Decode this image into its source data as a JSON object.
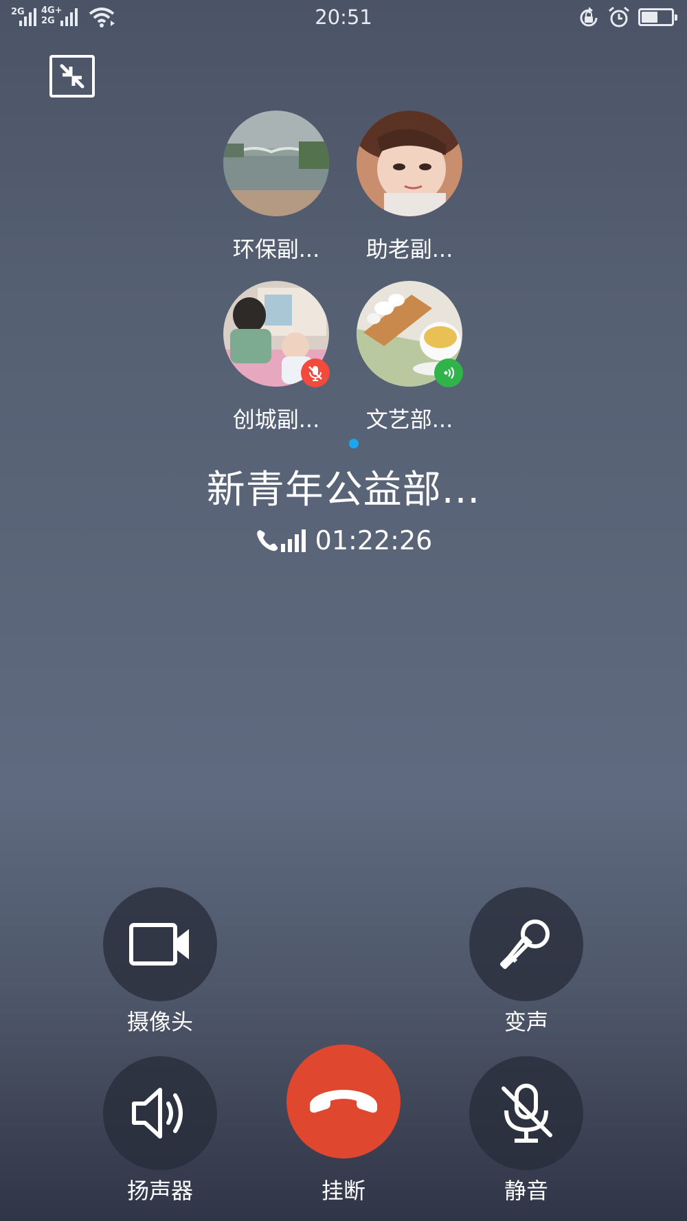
{
  "status_bar": {
    "sim1_label": "2G",
    "sim2_label_top": "4G+",
    "sim2_label_bottom": "2G",
    "time": "20:51",
    "icons": [
      "signal-icon",
      "wifi-icon",
      "rotation-lock-icon",
      "alarm-icon",
      "battery-icon"
    ],
    "battery_level": 0.55
  },
  "participants": [
    {
      "name": "环保副...",
      "status": "none"
    },
    {
      "name": "助老副...",
      "status": "none"
    },
    {
      "name": "创城副...",
      "status": "muted"
    },
    {
      "name": "文艺部...",
      "status": "speaking"
    }
  ],
  "call": {
    "title": "新青年公益部...",
    "duration": "01:22:26",
    "signal_level": 4
  },
  "controls": {
    "camera_label": "摄像头",
    "voice_changer_label": "变声",
    "speaker_label": "扬声器",
    "hangup_label": "挂断",
    "mute_label": "静音"
  },
  "colors": {
    "hangup": "#e0472f",
    "muted_badge": "#f24a3c",
    "speaking_badge": "#2fb34a",
    "page_indicator": "#1aa7f0"
  }
}
